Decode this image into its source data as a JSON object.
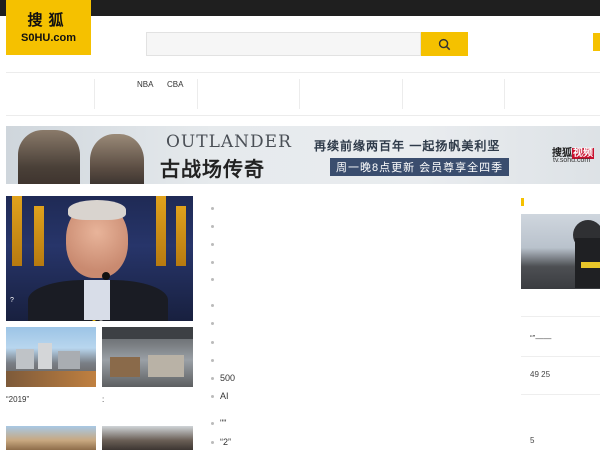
{
  "logo": {
    "cn": "搜狐",
    "en": "S0HU.com"
  },
  "nav": {
    "links": [
      "NBA",
      "CBA"
    ]
  },
  "banner": {
    "title_en": "OUTLANDER",
    "title_cn": "古战场传奇",
    "tagline": "再续前缘两百年 一起扬帆美利坚",
    "subtag": "周一晚8点更新 会员尊享全四季",
    "brand_main": "搜狐",
    "brand_accent": "视频",
    "brand_url": "tv.sohu.com"
  },
  "hero": {
    "caption": "?"
  },
  "thumbs": [
    {
      "caption": "“2019”"
    },
    {
      "caption": ":"
    }
  ],
  "bullets": [
    "500",
    "AI",
    "\"\"",
    "“2”"
  ],
  "right": {
    "line1": "“”——",
    "line2": "49 25",
    "line3": "5"
  },
  "colors": {
    "accent": "#f5c100",
    "topbar": "#1f1f1f",
    "brand_red": "#c8102e"
  }
}
